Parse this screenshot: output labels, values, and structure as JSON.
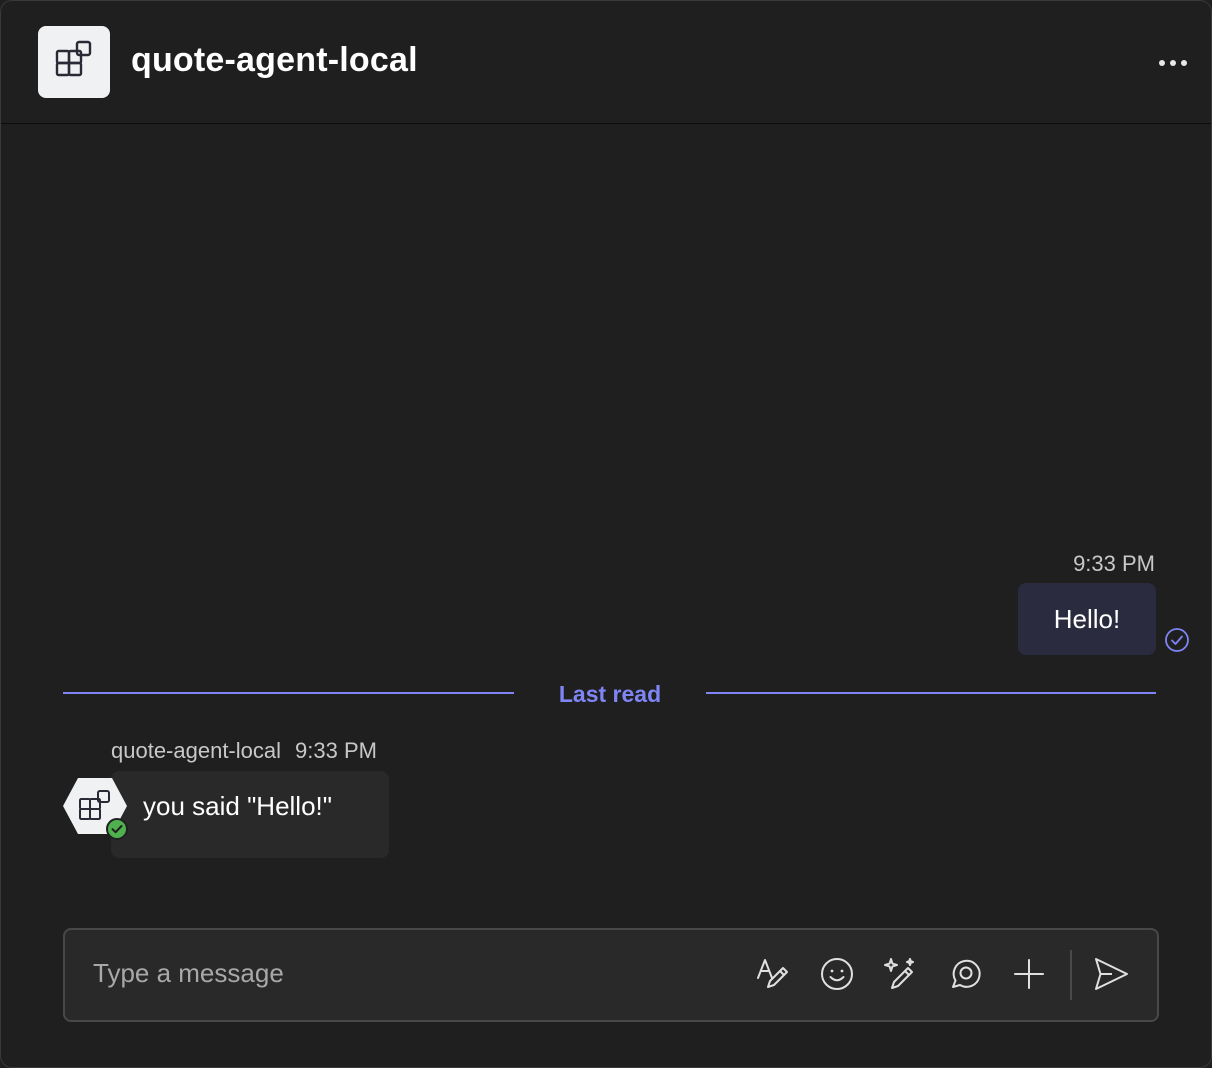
{
  "header": {
    "title": "quote-agent-local",
    "app_icon": "apps-icon",
    "more_icon": "more-horizontal-icon"
  },
  "messages": {
    "outgoing": {
      "time": "9:33 PM",
      "text": "Hello!",
      "status_icon": "read-check-icon"
    },
    "divider": {
      "label": "Last read"
    },
    "incoming": {
      "sender": "quote-agent-local",
      "time": "9:33 PM",
      "text": "you said \"Hello!\"",
      "avatar_icon": "apps-icon",
      "presence_icon": "available-check-icon"
    }
  },
  "composer": {
    "placeholder": "Type a message",
    "tools": [
      "format-icon",
      "emoji-icon",
      "copilot-icon",
      "loop-icon",
      "add-icon",
      "send-icon"
    ]
  },
  "colors": {
    "background": "#1f1f1f",
    "accent": "#7f85f5",
    "outgoing_bubble": "#2b2b40",
    "incoming_bubble": "#292929",
    "presence": "#4fb04e"
  }
}
